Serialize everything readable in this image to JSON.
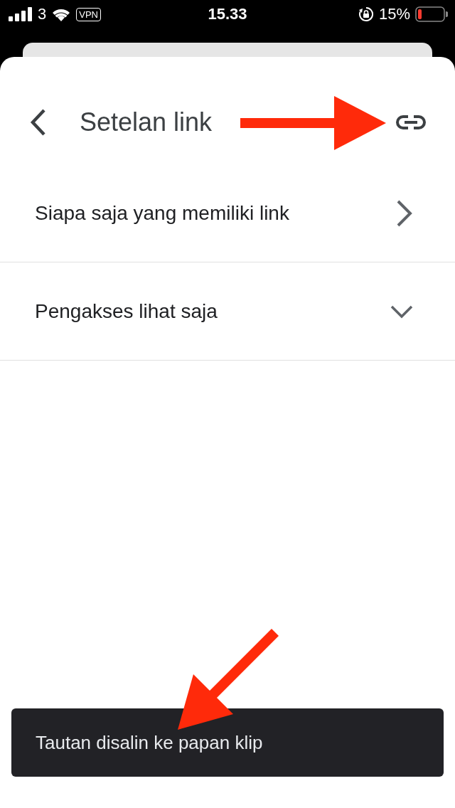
{
  "status_bar": {
    "carrier": "3",
    "vpn": "VPN",
    "time": "15.33",
    "battery": "15%"
  },
  "header": {
    "title": "Setelan link"
  },
  "rows": [
    {
      "label": "Siapa saja yang memiliki link",
      "kind": "navigate"
    },
    {
      "label": "Pengakses lihat saja",
      "kind": "dropdown"
    }
  ],
  "snackbar": {
    "message": "Tautan disalin ke papan klip"
  }
}
